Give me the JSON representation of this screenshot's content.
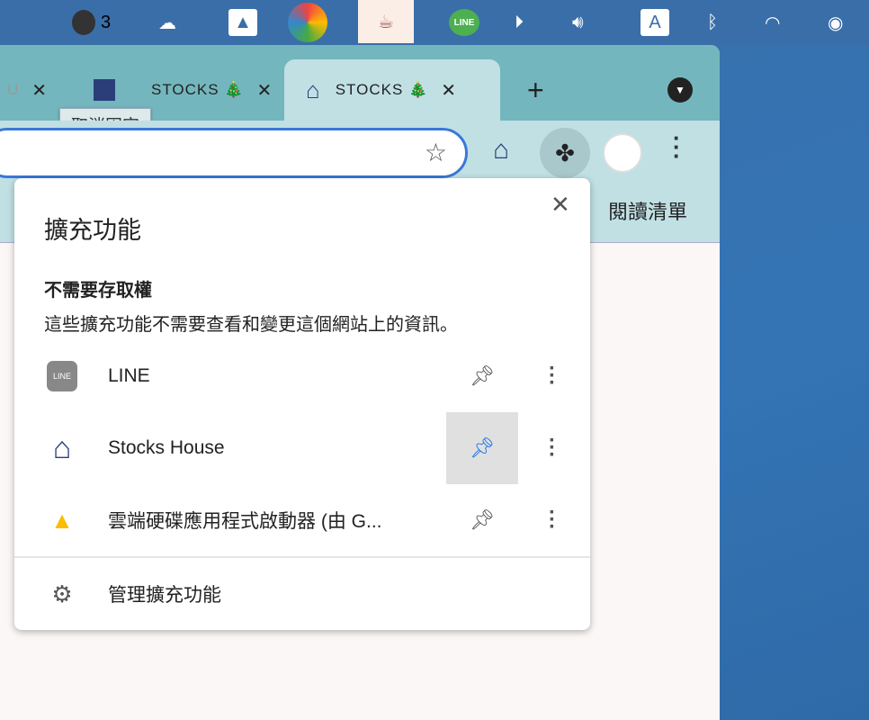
{
  "menubar": {
    "badge_count": "3",
    "line_label": "LINE",
    "input_method": "A"
  },
  "tabs": {
    "pinned_partial": "U",
    "middle_title": "STOCKS 🎄",
    "active_title": "STOCKS 🎄",
    "new_tab": "+",
    "tooltip": "取消固定"
  },
  "toolbar": {
    "reading_list": "閱讀清單"
  },
  "popup": {
    "title": "擴充功能",
    "section_title": "不需要存取權",
    "section_desc": "這些擴充功能不需要查看和變更這個網站上的資訊。",
    "items": [
      {
        "name": "LINE",
        "pinned": false
      },
      {
        "name": "Stocks House",
        "pinned": true
      },
      {
        "name": "雲端硬碟應用程式啟動器 (由 G...",
        "pinned": false
      }
    ],
    "manage": "管理擴充功能"
  },
  "colors": {
    "accent": "#1a73e8",
    "tabstrip": "#74b6bd",
    "toolbar": "#c0e0e4"
  }
}
